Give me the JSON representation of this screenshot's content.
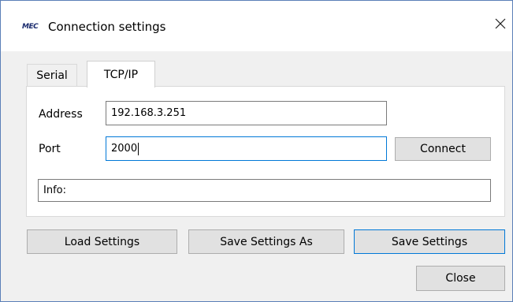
{
  "window": {
    "logo_text": "MEC",
    "title": "Connection settings",
    "close_icon": "close-icon"
  },
  "tabs": [
    {
      "label": "Serial",
      "selected": false
    },
    {
      "label": "TCP/IP",
      "selected": true
    }
  ],
  "tcpip": {
    "address_label": "Address",
    "address_value": "192.168.3.251",
    "port_label": "Port",
    "port_value": "2000",
    "connect_label": "Connect",
    "info_value": "Info:"
  },
  "footer": {
    "load_label": "Load Settings",
    "save_as_label": "Save Settings As",
    "save_label": "Save Settings",
    "close_label": "Close"
  }
}
